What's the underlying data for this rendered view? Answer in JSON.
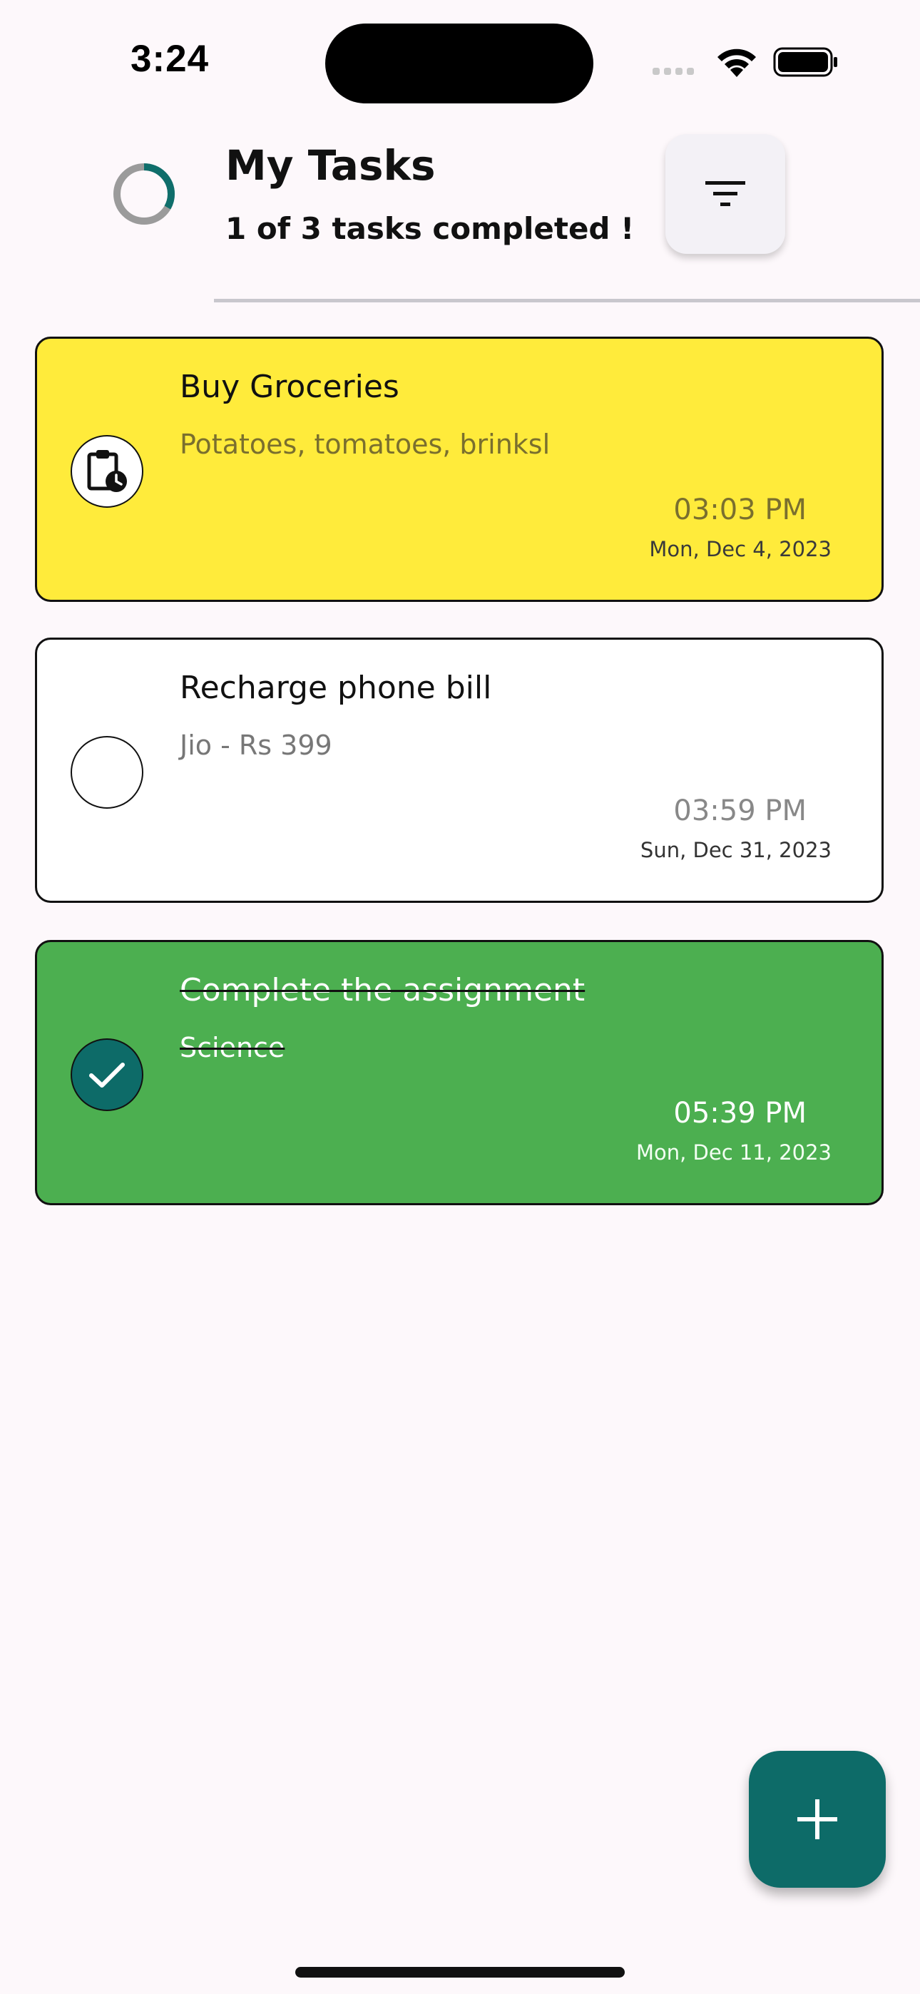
{
  "status_bar": {
    "time": "3:24"
  },
  "header": {
    "title": "My Tasks",
    "subtitle": "1 of 3 tasks completed !",
    "progress_fraction": 0.333,
    "progress_color": "#0f6e6b",
    "progress_track_color": "#9b9b9b",
    "filter_icon": "filter-icon"
  },
  "tasks": [
    {
      "title": "Buy Groceries",
      "description": "Potatoes, tomatoes, brinksl",
      "time": "03:03 PM",
      "date": "Mon, Dec 4, 2023",
      "status": "pending",
      "status_icon": "clipboard-clock-icon",
      "background": "#ffeb3b",
      "completed": false
    },
    {
      "title": "Recharge phone bill",
      "description": "Jio - Rs 399",
      "time": "03:59 PM",
      "date": "Sun, Dec 31, 2023",
      "status": "not-started",
      "status_icon": "empty-circle-icon",
      "background": "#ffffff",
      "completed": false
    },
    {
      "title": "Complete the assignment",
      "description": "Science",
      "time": "05:39 PM",
      "date": "Mon, Dec 11, 2023",
      "status": "completed",
      "status_icon": "check-icon",
      "background": "#4caf50",
      "completed": true
    }
  ],
  "fab": {
    "icon": "plus-icon",
    "color": "#0d6b68"
  }
}
